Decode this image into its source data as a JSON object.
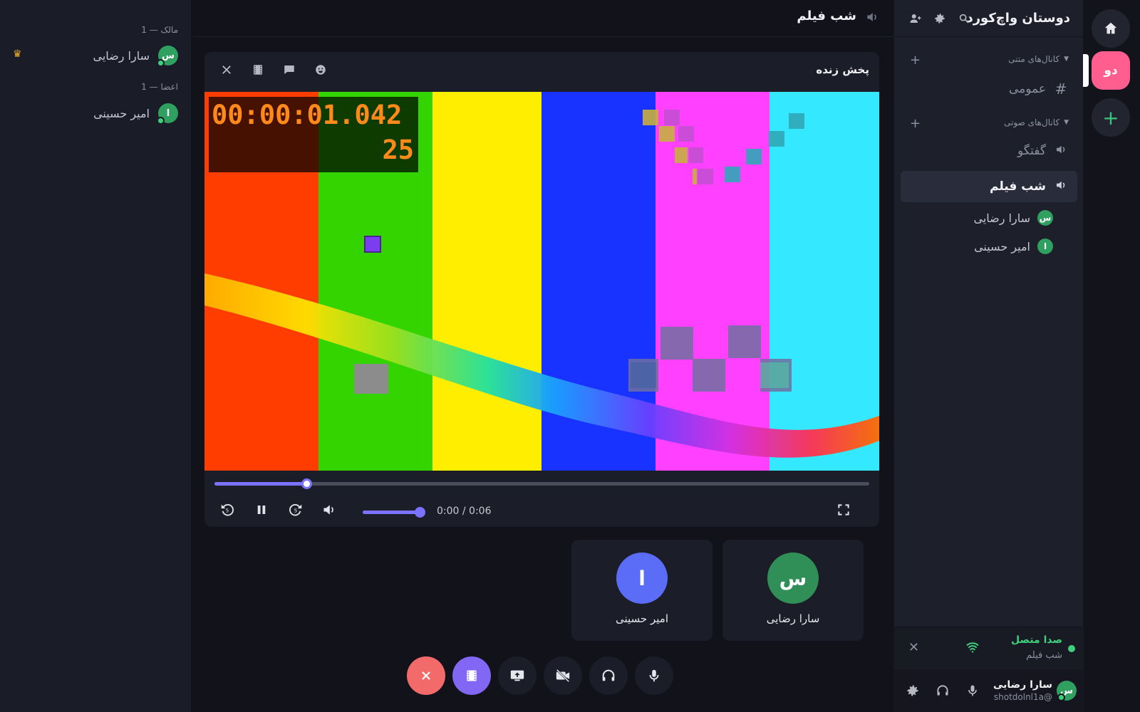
{
  "server": {
    "name": "دوستان واچ‌کورد",
    "badge": "دو"
  },
  "categories": {
    "text": "کانال‌های متنی",
    "voice": "کانال‌های صوتی"
  },
  "channels": {
    "text_general": "عمومی",
    "voice_chat": "گفتگو",
    "voice_movie": "شب فیلم"
  },
  "voice_members": [
    {
      "name": "سارا رضایی",
      "initial": "س"
    },
    {
      "name": "امیر حسینی",
      "initial": "ا"
    }
  ],
  "voice_status": {
    "status": "صدا متصل",
    "channel": "شب فیلم"
  },
  "user": {
    "name": "سارا رضایی",
    "tag": "shotdolnl1a@",
    "initial": "س"
  },
  "main_header": {
    "title": "شب فیلم"
  },
  "player": {
    "title": "پخش زنده",
    "time": "0:00 / 0:06",
    "progress": 0.14,
    "volume": 1.0,
    "video_timecode": "00:00:01.042",
    "video_frame": "25"
  },
  "tiles": [
    {
      "name": "سارا رضایی",
      "initial": "س",
      "color": "#2f8f57"
    },
    {
      "name": "امیر حسینی",
      "initial": "ا",
      "color": "#5b6cf6"
    }
  ],
  "member_list": {
    "owner_group": "مالک — 1",
    "owner_name": "سارا رضایی",
    "owner_initial": "س",
    "members_group": "اعضا — 1",
    "member_name": "امیر حسینی",
    "member_initial": "ا"
  },
  "colors": {
    "accent": "#7b72ff",
    "online": "#3fd07f",
    "hangup": "#f26a6a",
    "server": "#ff5e8e"
  }
}
